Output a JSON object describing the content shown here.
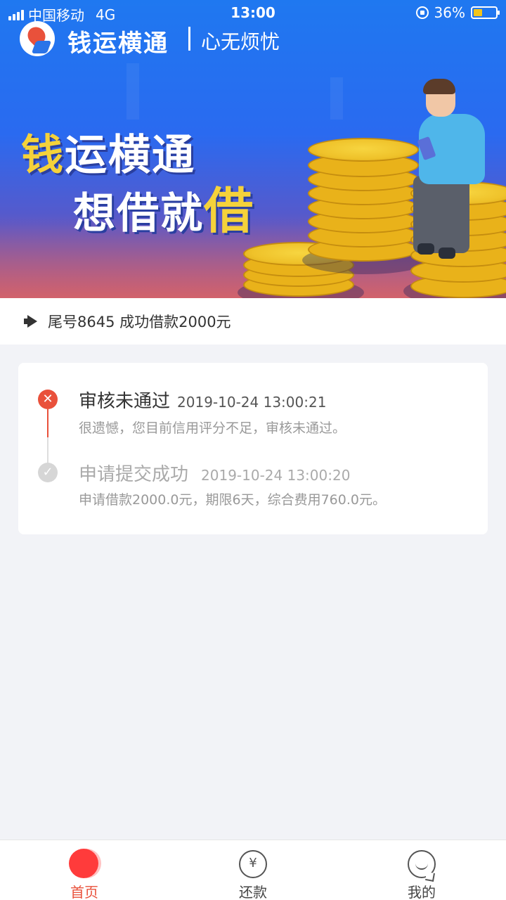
{
  "status_bar": {
    "carrier": "中国移动",
    "network": "4G",
    "time": "13:00",
    "battery": "36%"
  },
  "banner": {
    "app_name": "钱运横通",
    "slogan": "心无烦忧",
    "headline_line1_highlight": "钱",
    "headline_line1_rest": "运横通",
    "headline_line2_rest": "想借就",
    "headline_line2_highlight": "借"
  },
  "notice": {
    "text": "尾号8645 成功借款2000元"
  },
  "timeline": [
    {
      "title": "审核未通过",
      "time": "2019-10-24 13:00:21",
      "desc": "很遗憾，您目前信用评分不足，审核未通过。",
      "status": "failed"
    },
    {
      "title": "申请提交成功",
      "time": "2019-10-24 13:00:20",
      "desc": "申请借款2000.0元，期限6天，综合费用760.0元。",
      "status": "done"
    }
  ],
  "tabbar": {
    "home": "首页",
    "repay": "还款",
    "mine": "我的",
    "repay_icon_glyph": "¥",
    "active": "home"
  },
  "colors": {
    "accent": "#e9513b",
    "tab_active": "#ff3b3b",
    "coin": "#efc22a",
    "banner_blue": "#1f78f0"
  },
  "icons": {
    "step1": "close-icon",
    "step2": "check-icon",
    "notice": "megaphone-icon"
  }
}
